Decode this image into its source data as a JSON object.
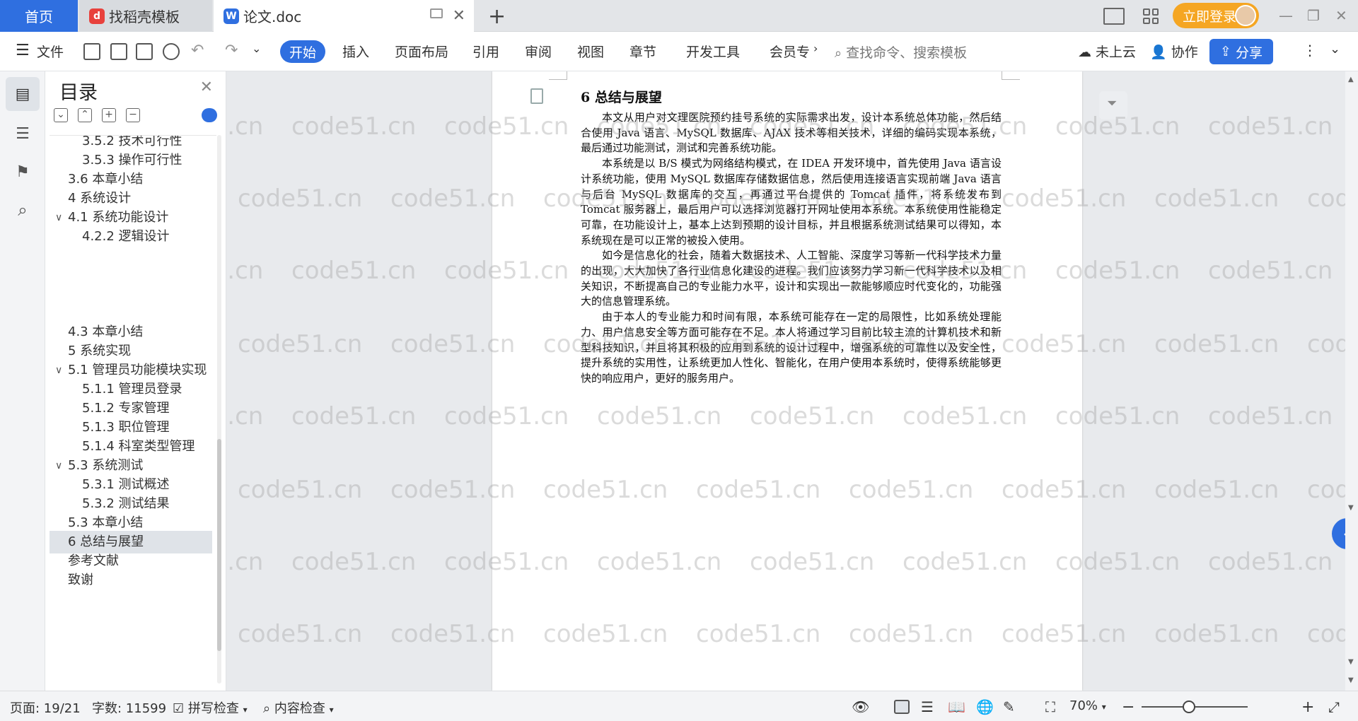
{
  "tabs": {
    "home": "首页",
    "template": "找稻壳模板",
    "doc": "论文.doc",
    "add": "+"
  },
  "account": {
    "login": "立即登录"
  },
  "ribbon": {
    "file": "文件",
    "tabs": [
      "开始",
      "插入",
      "页面布局",
      "引用",
      "审阅",
      "视图",
      "章节",
      "开发工具",
      "会员专"
    ],
    "search_placeholder": "查找命令、搜索模板",
    "cloud": "未上云",
    "collab": "协作",
    "share": "分享"
  },
  "toc": {
    "title": "目录",
    "items": [
      {
        "label": "3.5.2 技术可行性",
        "level": 3
      },
      {
        "label": "3.5.3 操作可行性",
        "level": 3
      },
      {
        "label": "3.6 本章小结",
        "level": 2
      },
      {
        "label": "4 系统设计",
        "level": 1
      },
      {
        "label": "4.1 系统功能设计",
        "level": 2,
        "expanded": true
      },
      {
        "label": "4.2.2 逻辑设计",
        "level": 3
      },
      {
        "label": "4.3 本章小结",
        "level": 2
      },
      {
        "label": "5 系统实现",
        "level": 1
      },
      {
        "label": "5.1 管理员功能模块实现",
        "level": 2,
        "expanded": true
      },
      {
        "label": "5.1.1 管理员登录",
        "level": 3
      },
      {
        "label": "5.1.2 专家管理",
        "level": 3
      },
      {
        "label": "5.1.3 职位管理",
        "level": 3
      },
      {
        "label": "5.1.4 科室类型管理",
        "level": 3
      },
      {
        "label": "5.3 系统测试",
        "level": 2,
        "expanded": true
      },
      {
        "label": "5.3.1 测试概述",
        "level": 3
      },
      {
        "label": "5.3.2 测试结果",
        "level": 3
      },
      {
        "label": "5.3 本章小结",
        "level": 2
      },
      {
        "label": "6 总结与展望",
        "level": 2,
        "selected": true
      },
      {
        "label": "参考文献",
        "level": 2
      },
      {
        "label": "致谢",
        "level": 2
      }
    ]
  },
  "document": {
    "heading": "6 总结与展望",
    "paragraphs": [
      "本文从用户对文理医院预约挂号系统的实际需求出发，设计本系统总体功能，然后结合使用 Java 语言、MySQL 数据库、AJAX 技术等相关技术，详细的编码实现本系统，最后通过功能测试，测试和完善系统功能。",
      "本系统是以 B/S 模式为网络结构模式，在 IDEA 开发环境中，首先使用 Java 语言设计系统功能，使用 MySQL 数据库存储数据信息，然后使用连接语言实现前端 Java 语言与后台 MySQL 数据库的交互，再通过平台提供的 Tomcat 插件，将系统发布到 Tomcat 服务器上，最后用户可以选择浏览器打开网址使用本系统。本系统使用性能稳定可靠，在功能设计上，基本上达到预期的设计目标，并且根据系统测试结果可以得知，本系统现在是可以正常的被投入使用。",
      "如今是信息化的社会，随着大数据技术、人工智能、深度学习等新一代科学技术力量的出现，大大加快了各行业信息化建设的进程。我们应该努力学习新一代科学技术以及相关知识，不断提高自己的专业能力水平，设计和实现出一款能够顺应时代变化的，功能强大的信息管理系统。",
      "由于本人的专业能力和时间有限，本系统可能存在一定的局限性，比如系统处理能力、用户信息安全等方面可能存在不足。本人将通过学习目前比较主流的计算机技术和新型科技知识，并且将其积极的应用到系统的设计过程中，增强系统的可靠性以及安全性，提升系统的实用性，让系统更加人性化、智能化，在用户使用本系统时，使得系统能够更快的响应用户，更好的服务用户。"
    ]
  },
  "watermark": "code51.cn",
  "status": {
    "page": "页面: 19/21",
    "words": "字数: 11599",
    "spell": "拼写检查",
    "content_check": "内容检查",
    "zoom": "70%"
  }
}
